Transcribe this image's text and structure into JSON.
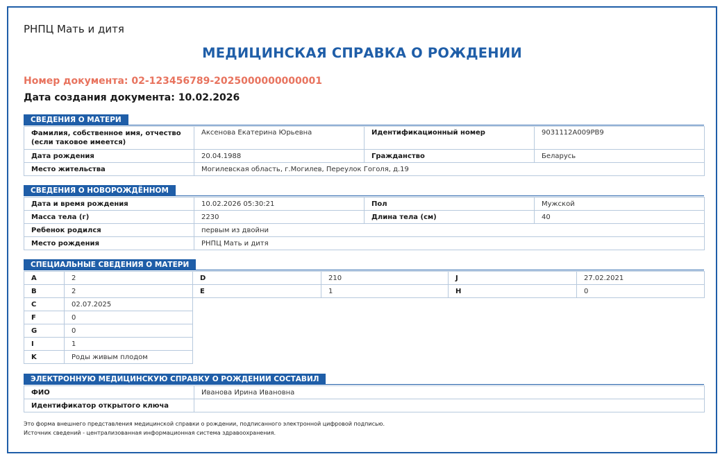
{
  "header": {
    "organization": "РНПЦ Мать и дитя",
    "title": "МЕДИЦИНСКАЯ СПРАВКА О РОЖДЕНИИ",
    "document_number": "Номер документа: 02-123456789-2025000000000001",
    "creation_date": "Дата создания документа: 10.02.2026"
  },
  "mother": {
    "section_title": "СВЕДЕНИЯ О МАТЕРИ",
    "full_name_label": "Фамилия, собственное имя, отчество (если таковое имеется)",
    "full_name": "Аксенова Екатерина Юрьевна",
    "id_label": "Идентификационный номер",
    "id": "9031112A009PB9",
    "birth_date_label": "Дата рождения",
    "birth_date": "20.04.1988",
    "citizenship_label": "Гражданство",
    "citizenship": "Беларусь",
    "residence_label": "Место жительства",
    "residence": "Могилевская область, г.Могилев, Переулок Гоголя, д.19"
  },
  "newborn": {
    "section_title": "СВЕДЕНИЯ О НОВОРОЖДЁННОМ",
    "birth_datetime_label": "Дата и время рождения",
    "birth_datetime": "10.02.2026 05:30:21",
    "sex_label": "Пол",
    "sex": "Мужской",
    "weight_label": "Масса тела (г)",
    "weight": "2230",
    "length_label": "Длина тела (см)",
    "length": "40",
    "born_label": "Ребенок родился",
    "born": "первым из двойни",
    "place_label": "Место рождения",
    "place": "РНПЦ Мать и дитя"
  },
  "special": {
    "section_title": "СПЕЦИАЛЬНЫЕ СВЕДЕНИЯ О МАТЕРИ",
    "A_label": "A",
    "A": "2",
    "D_label": "D",
    "D": "210",
    "J_label": "J",
    "J": "27.02.2021",
    "B_label": "B",
    "B": "2",
    "E_label": "E",
    "E": "1",
    "H_label": "H",
    "H": "0",
    "C_label": "C",
    "C": "02.07.2025",
    "F_label": "F",
    "F": "0",
    "G_label": "G",
    "G": "0",
    "I_label": "I",
    "I": "1",
    "K_label": "K",
    "K": "Роды живым плодом"
  },
  "composer": {
    "section_title": "ЭЛЕКТРОННУЮ МЕДИЦИНСКУЮ СПРАВКУ О РОЖДЕНИИ СОСТАВИЛ",
    "name_label": "ФИО",
    "name": "Иванова Ирина Ивановна",
    "key_label": "Идентификатор открытого ключа",
    "key": ""
  },
  "footer": {
    "line1": "Это форма внешнего представления медицинской справки о рождении, подписанного электронной цифровой подписью.",
    "line2": "Источник сведений - централизованная информационная система здравоохранения."
  },
  "colors": {
    "accent": "#1f5ea8",
    "document_number": "#e8735e",
    "border": "#b7c9dd"
  }
}
